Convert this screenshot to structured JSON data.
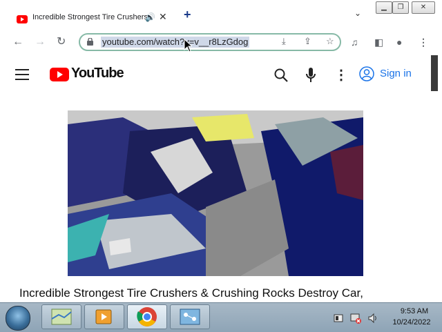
{
  "browser": {
    "tab": {
      "title": "Incredible Strongest Tire Crushers & Crushing Rocks Destroy Car,",
      "audio_icon": "speaker-icon",
      "close_icon": "close-icon"
    },
    "new_tab_icon": "plus-icon",
    "tab_search_icon": "chevron-down-icon",
    "window_controls": [
      "minimize-icon",
      "restore-icon",
      "close-icon"
    ],
    "address": {
      "url": "youtube.com/watch?v=v__r8LzGdog"
    },
    "colors": {
      "omnibox_border": "#86b9a6",
      "url_selection": "#cfd8e8"
    }
  },
  "youtube": {
    "wordmark": "YouTube",
    "signin_label": "Sign in",
    "video_title": "Incredible Strongest Tire Crushers & Crushing Rocks Destroy Car,",
    "colors": {
      "brand_red": "#ff0000",
      "signin_blue": "#1a73e8"
    }
  },
  "taskbar": {
    "time": "9:53 AM",
    "date": "10/24/2022",
    "apps": [
      "start-orb-icon",
      "maps-app-icon",
      "media-player-icon",
      "chrome-icon",
      "network-app-icon"
    ],
    "tray_icons": [
      "action-center-icon",
      "network-warning-icon",
      "volume-icon"
    ]
  }
}
